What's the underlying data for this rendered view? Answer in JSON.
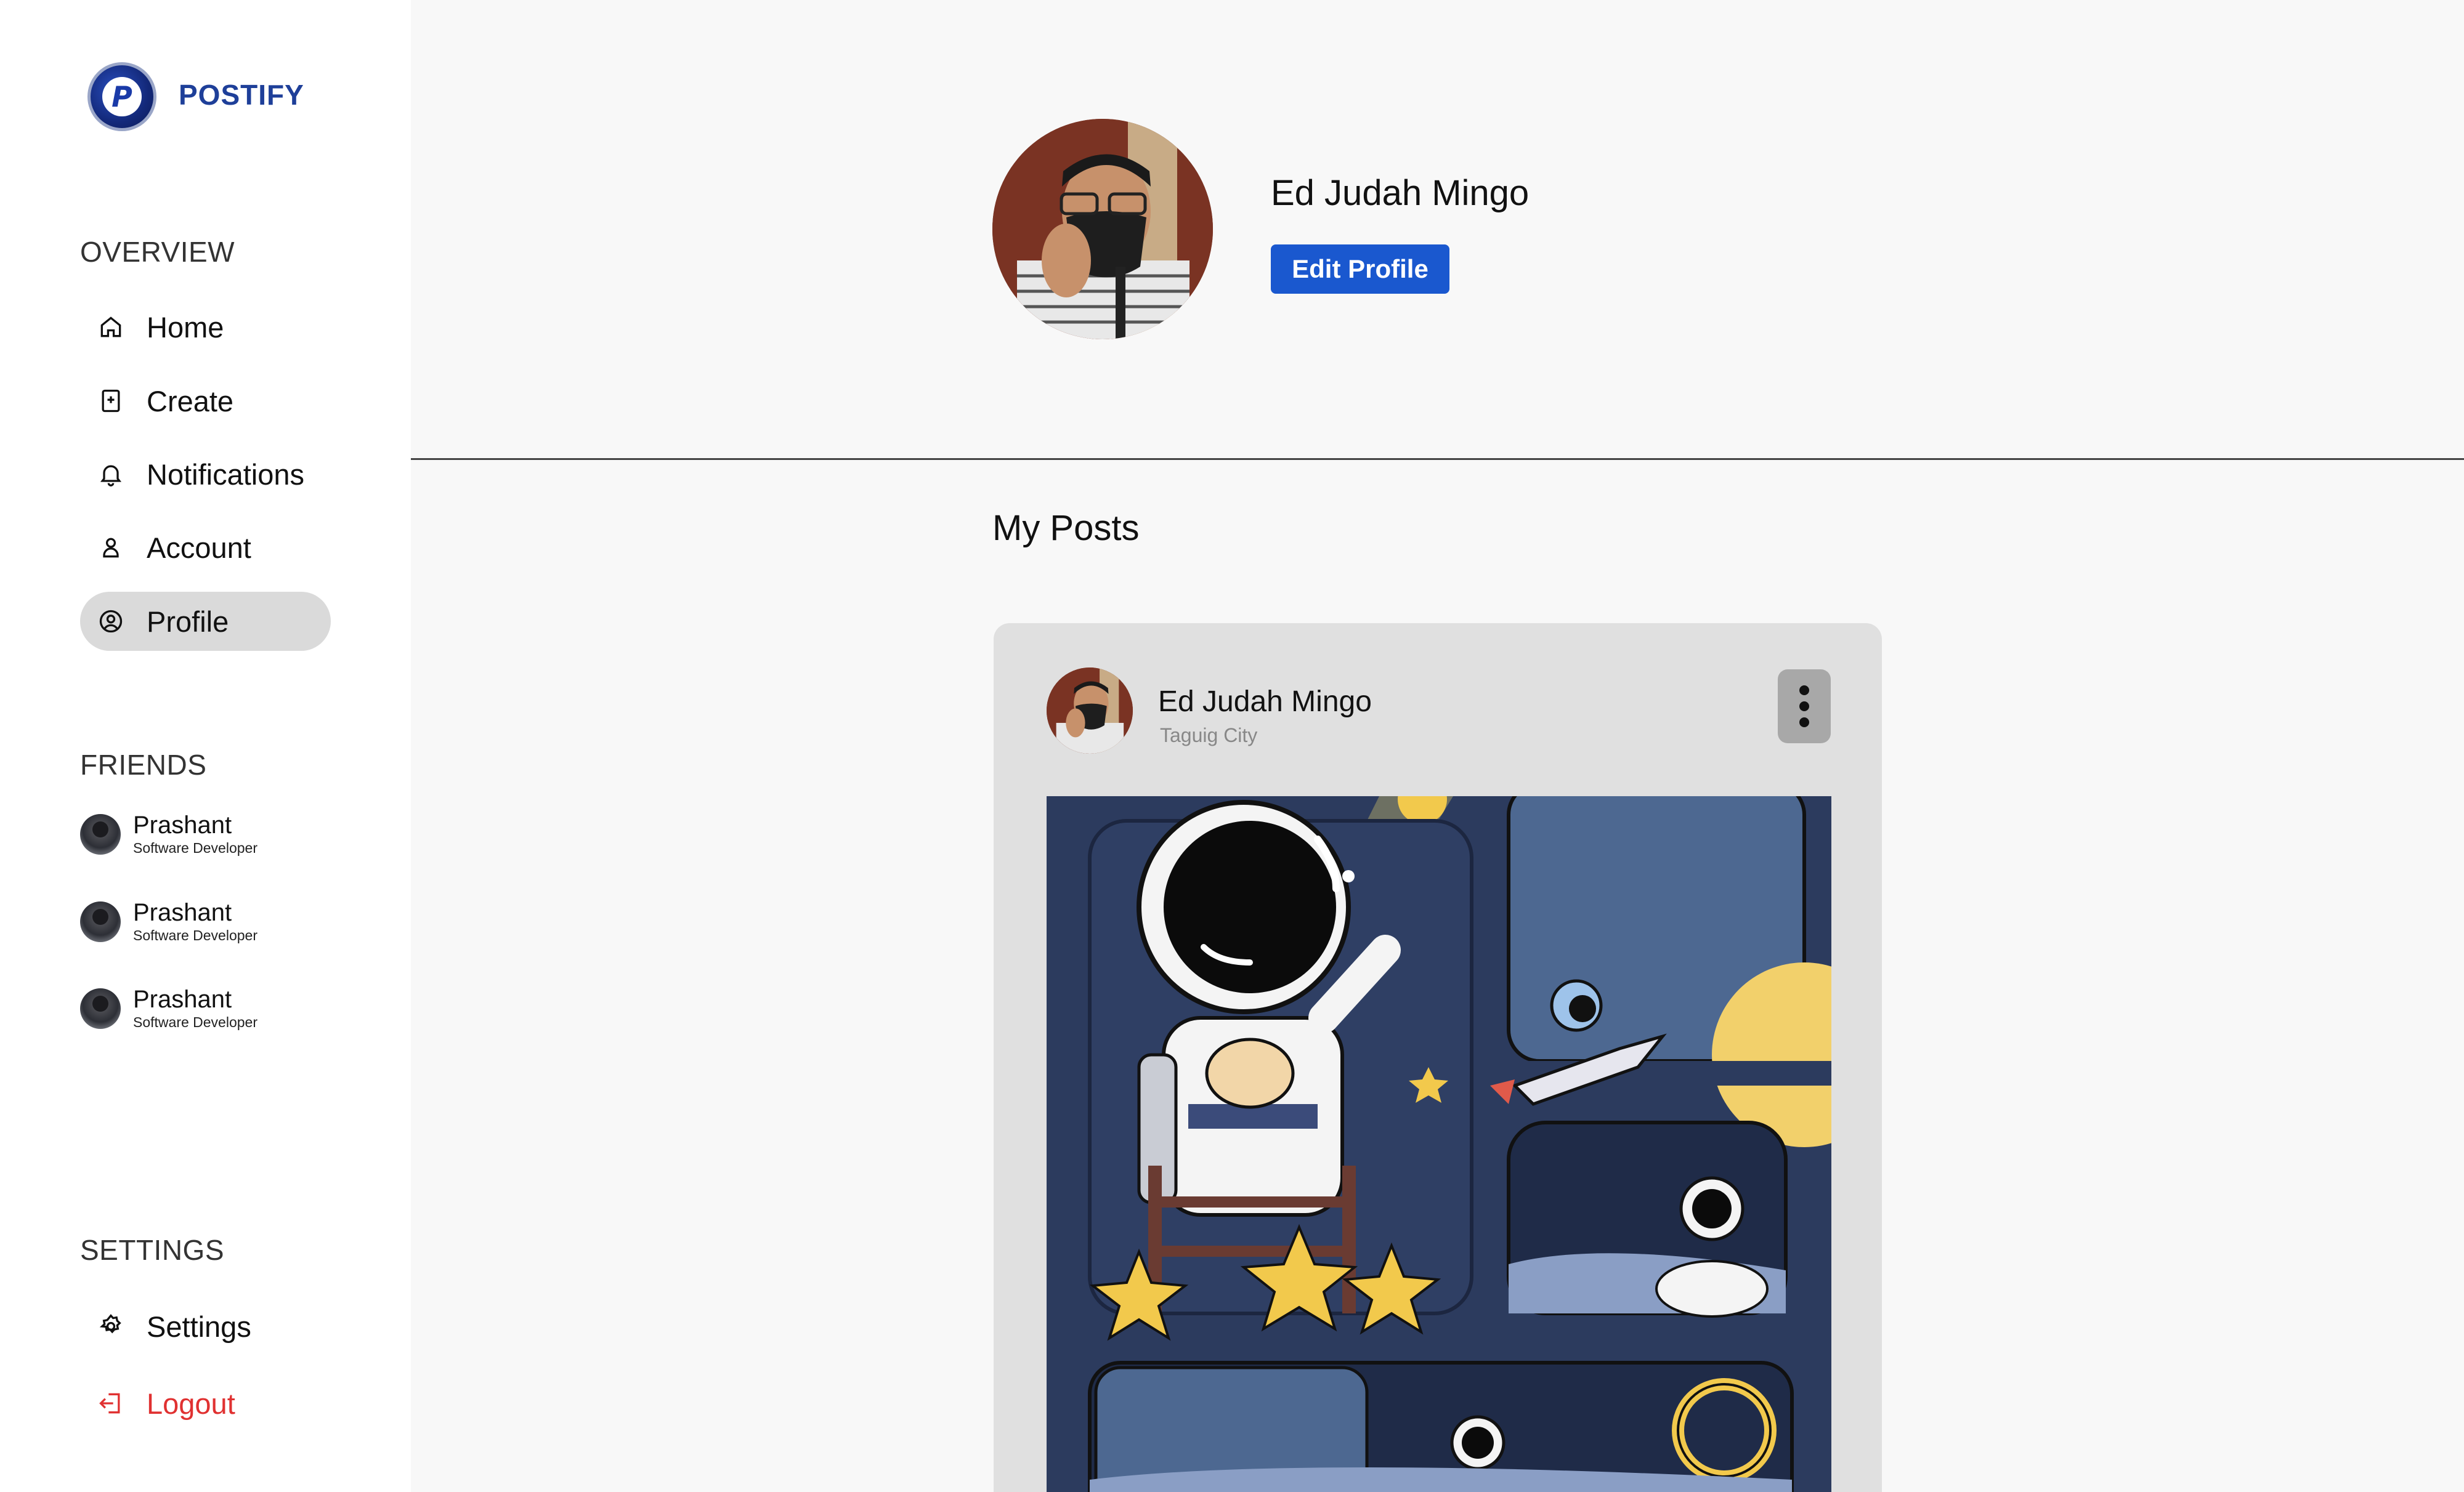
{
  "brand": {
    "name": "POSTIFY"
  },
  "sidebar": {
    "overview_title": "OVERVIEW",
    "nav": [
      {
        "label": "Home",
        "icon": "home-icon"
      },
      {
        "label": "Create",
        "icon": "create-icon"
      },
      {
        "label": "Notifications",
        "icon": "bell-icon"
      },
      {
        "label": "Account",
        "icon": "user-icon"
      },
      {
        "label": "Profile",
        "icon": "profile-icon",
        "active": true
      }
    ],
    "friends_title": "FRIENDS",
    "friends": [
      {
        "name": "Prashant",
        "role": "Software Developer"
      },
      {
        "name": "Prashant",
        "role": "Software Developer"
      },
      {
        "name": "Prashant",
        "role": "Software Developer"
      }
    ],
    "settings_title": "SETTINGS",
    "settings_label": "Settings",
    "logout_label": "Logout"
  },
  "profile": {
    "name": "Ed Judah Mingo",
    "edit_label": "Edit Profile"
  },
  "posts": {
    "title": "My Posts",
    "items": [
      {
        "author": "Ed Judah Mingo",
        "location": "Taguig City"
      }
    ]
  },
  "colors": {
    "brand": "#1e3f99",
    "primary_button": "#1a58cf",
    "logout": "#e03131",
    "active_nav": "#dadada"
  }
}
